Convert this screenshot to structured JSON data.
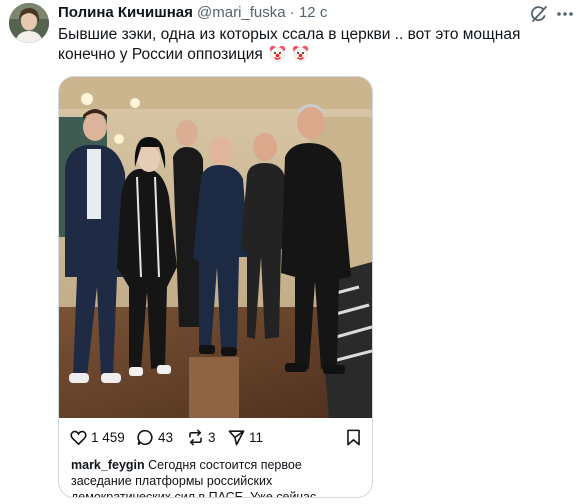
{
  "tweet": {
    "author": "Полина Кичишная",
    "handle": "@mari_fuska",
    "separator": "·",
    "time": "12 с",
    "text": "Бывшие зэки, одна из которых ссала в церкви .. вот это мощная конечно у России оппозиция",
    "emojis": [
      "clown-face-icon",
      "clown-face-icon"
    ]
  },
  "embed": {
    "image_icon": "group-photo",
    "likes": "1 459",
    "comments": "43",
    "reposts": "3",
    "shares": "11",
    "caption_user": "mark_feygin",
    "caption_text": "Сегодня состоится первое заседание платформы российских демократических сил в ПАСЕ. Уже сейчас"
  },
  "colors": {
    "text": "#0f1419",
    "muted": "#536471",
    "border": "#cfd9de"
  }
}
